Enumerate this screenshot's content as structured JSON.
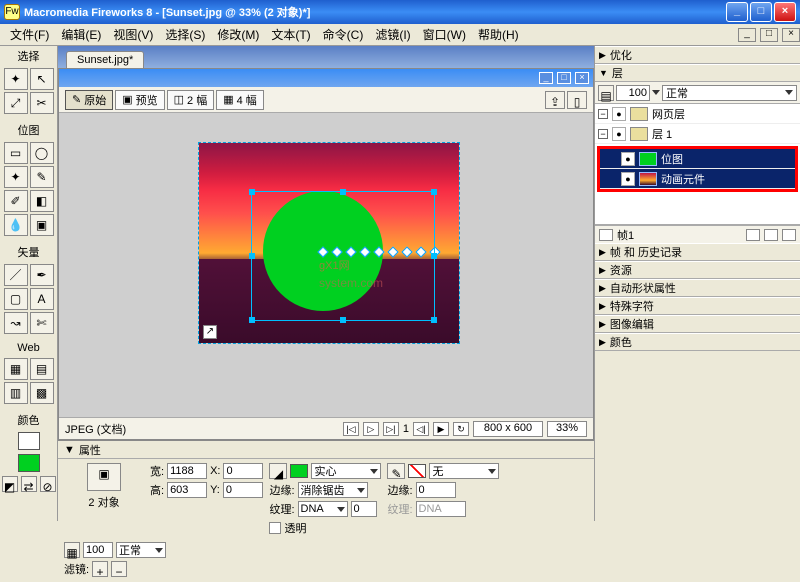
{
  "titlebar": {
    "app_name": "Macromedia Fireworks 8",
    "doc_suffix": " - [Sunset.jpg @ 33% (2 对象)*]"
  },
  "menu": [
    "文件(F)",
    "编辑(E)",
    "视图(V)",
    "选择(S)",
    "修改(M)",
    "文本(T)",
    "命令(C)",
    "滤镜(I)",
    "窗口(W)",
    "帮助(H)"
  ],
  "left": {
    "select_title": "选择",
    "bitmap_title": "位图",
    "vector_title": "矢量",
    "web_title": "Web",
    "color_title": "颜色"
  },
  "doc": {
    "tab": "Sunset.jpg*",
    "toolbar": {
      "original": "原始",
      "preview": "预览",
      "two": "2 幅",
      "four": "4 幅"
    },
    "watermark": "gX1网",
    "watermark_sub": "system.com",
    "status_left": "JPEG (文档)",
    "play_frame": "1",
    "canvas_size": "800 x 600",
    "zoom": "33%"
  },
  "right": {
    "optimize": "优化",
    "layers": "层",
    "opacity": "100",
    "blend": "正常",
    "layer_web": "网页层",
    "layer_1": "层 1",
    "item_bitmap": "位图",
    "item_anim": "动画元件",
    "frame_label": "帧1",
    "panels": [
      "帧 和 历史记录",
      "资源",
      "自动形状属性",
      "特殊字符",
      "图像编辑",
      "颜色"
    ]
  },
  "props": {
    "title": "属性",
    "obj_label": "2 对象",
    "fill_solid": "实心",
    "edge_label": "边缘:",
    "edge_val": "消除锯齿",
    "texture_label": "纹理:",
    "texture_val": "DNA",
    "texture_pct": "0",
    "transparent": "透明",
    "stroke_none": "无",
    "stroke_edge": "边缘:",
    "stroke_edge_v": "0",
    "stroke_tex": "纹理:",
    "opacity": "100",
    "blend": "正常",
    "filters": "滤镜:",
    "w_label": "宽:",
    "w": "1188",
    "h_label": "高:",
    "h": "603",
    "x_label": "X:",
    "x": "0",
    "y_label": "Y:",
    "y": "0"
  },
  "icons": {
    "minus": "_",
    "max": "□",
    "close": "×",
    "tri_right": "▶",
    "tri_down": "▼",
    "plus": "+",
    "minus_s": "−",
    "eye": "●",
    "play_first": "▷",
    "prev": "◁",
    "next": "▷|",
    "last": "▶",
    "loop": "↻"
  }
}
